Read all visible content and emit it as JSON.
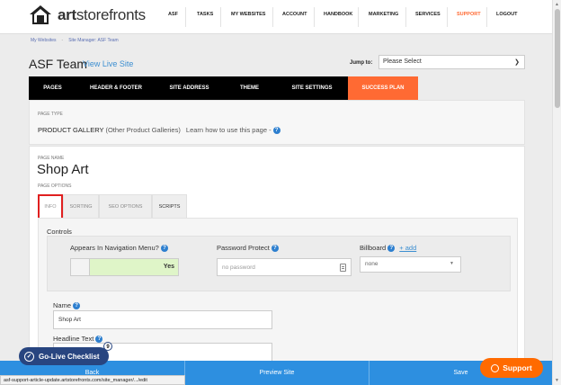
{
  "brand": {
    "logo_text_bold": "art",
    "logo_text_rest": "storefronts"
  },
  "nav": [
    {
      "label": "ASF"
    },
    {
      "label": "TASKS"
    },
    {
      "label": "MY WEBSITES"
    },
    {
      "label": "ACCOUNT"
    },
    {
      "label": "HANDBOOK"
    },
    {
      "label": "MARKETING"
    },
    {
      "label": "SERVICES"
    },
    {
      "label": "SUPPORT"
    },
    {
      "label": "LOGOUT"
    }
  ],
  "breadcrumb": {
    "item1": "My Websites",
    "sep": "-",
    "item2": "Site Manager: ASF Team"
  },
  "header": {
    "title": "ASF Team",
    "view_live": "View Live Site",
    "jump_label": "Jump to:",
    "jump_value": "Please Select"
  },
  "tabs": [
    {
      "label": "PAGES"
    },
    {
      "label": "HEADER & FOOTER"
    },
    {
      "label": "SITE ADDRESS"
    },
    {
      "label": "THEME"
    },
    {
      "label": "SITE SETTINGS"
    },
    {
      "label": "SUCCESS PLAN"
    }
  ],
  "page_type": {
    "label": "PAGE TYPE",
    "value": "PRODUCT GALLERY",
    "sub": "(Other Product Galleries)",
    "learn": "Learn how to use this page -"
  },
  "page_name": {
    "label": "PAGE NAME",
    "value": "Shop Art"
  },
  "page_options": {
    "label": "PAGE OPTIONS"
  },
  "subtabs": [
    {
      "label": "INFO"
    },
    {
      "label": "SORTING"
    },
    {
      "label": "SEO OPTIONS"
    },
    {
      "label": "SCRIPTS"
    }
  ],
  "controls": {
    "title": "Controls",
    "nav_label": "Appears In Navigation Menu?",
    "nav_value": "Yes",
    "pwd_label": "Password Protect",
    "pwd_placeholder": "no password",
    "billboard_label": "Billboard",
    "billboard_add": "+ add",
    "billboard_value": "none"
  },
  "fields": {
    "name_label": "Name",
    "name_value": "Shop Art",
    "headline_label": "Headline Text"
  },
  "bottom": {
    "back": "Back",
    "preview": "Preview Site",
    "save": "Save"
  },
  "status_url": "asf-support-article-update.artstorefronts.com/site_manager/.../edit",
  "golive": {
    "label": "Go-Live Checklist",
    "count": "9"
  },
  "support_button": {
    "label": "Support"
  },
  "colors": {
    "accent": "#ff6a33",
    "link": "#3d8fd1",
    "bottombar": "#2d8fe0",
    "navy": "#284580"
  }
}
